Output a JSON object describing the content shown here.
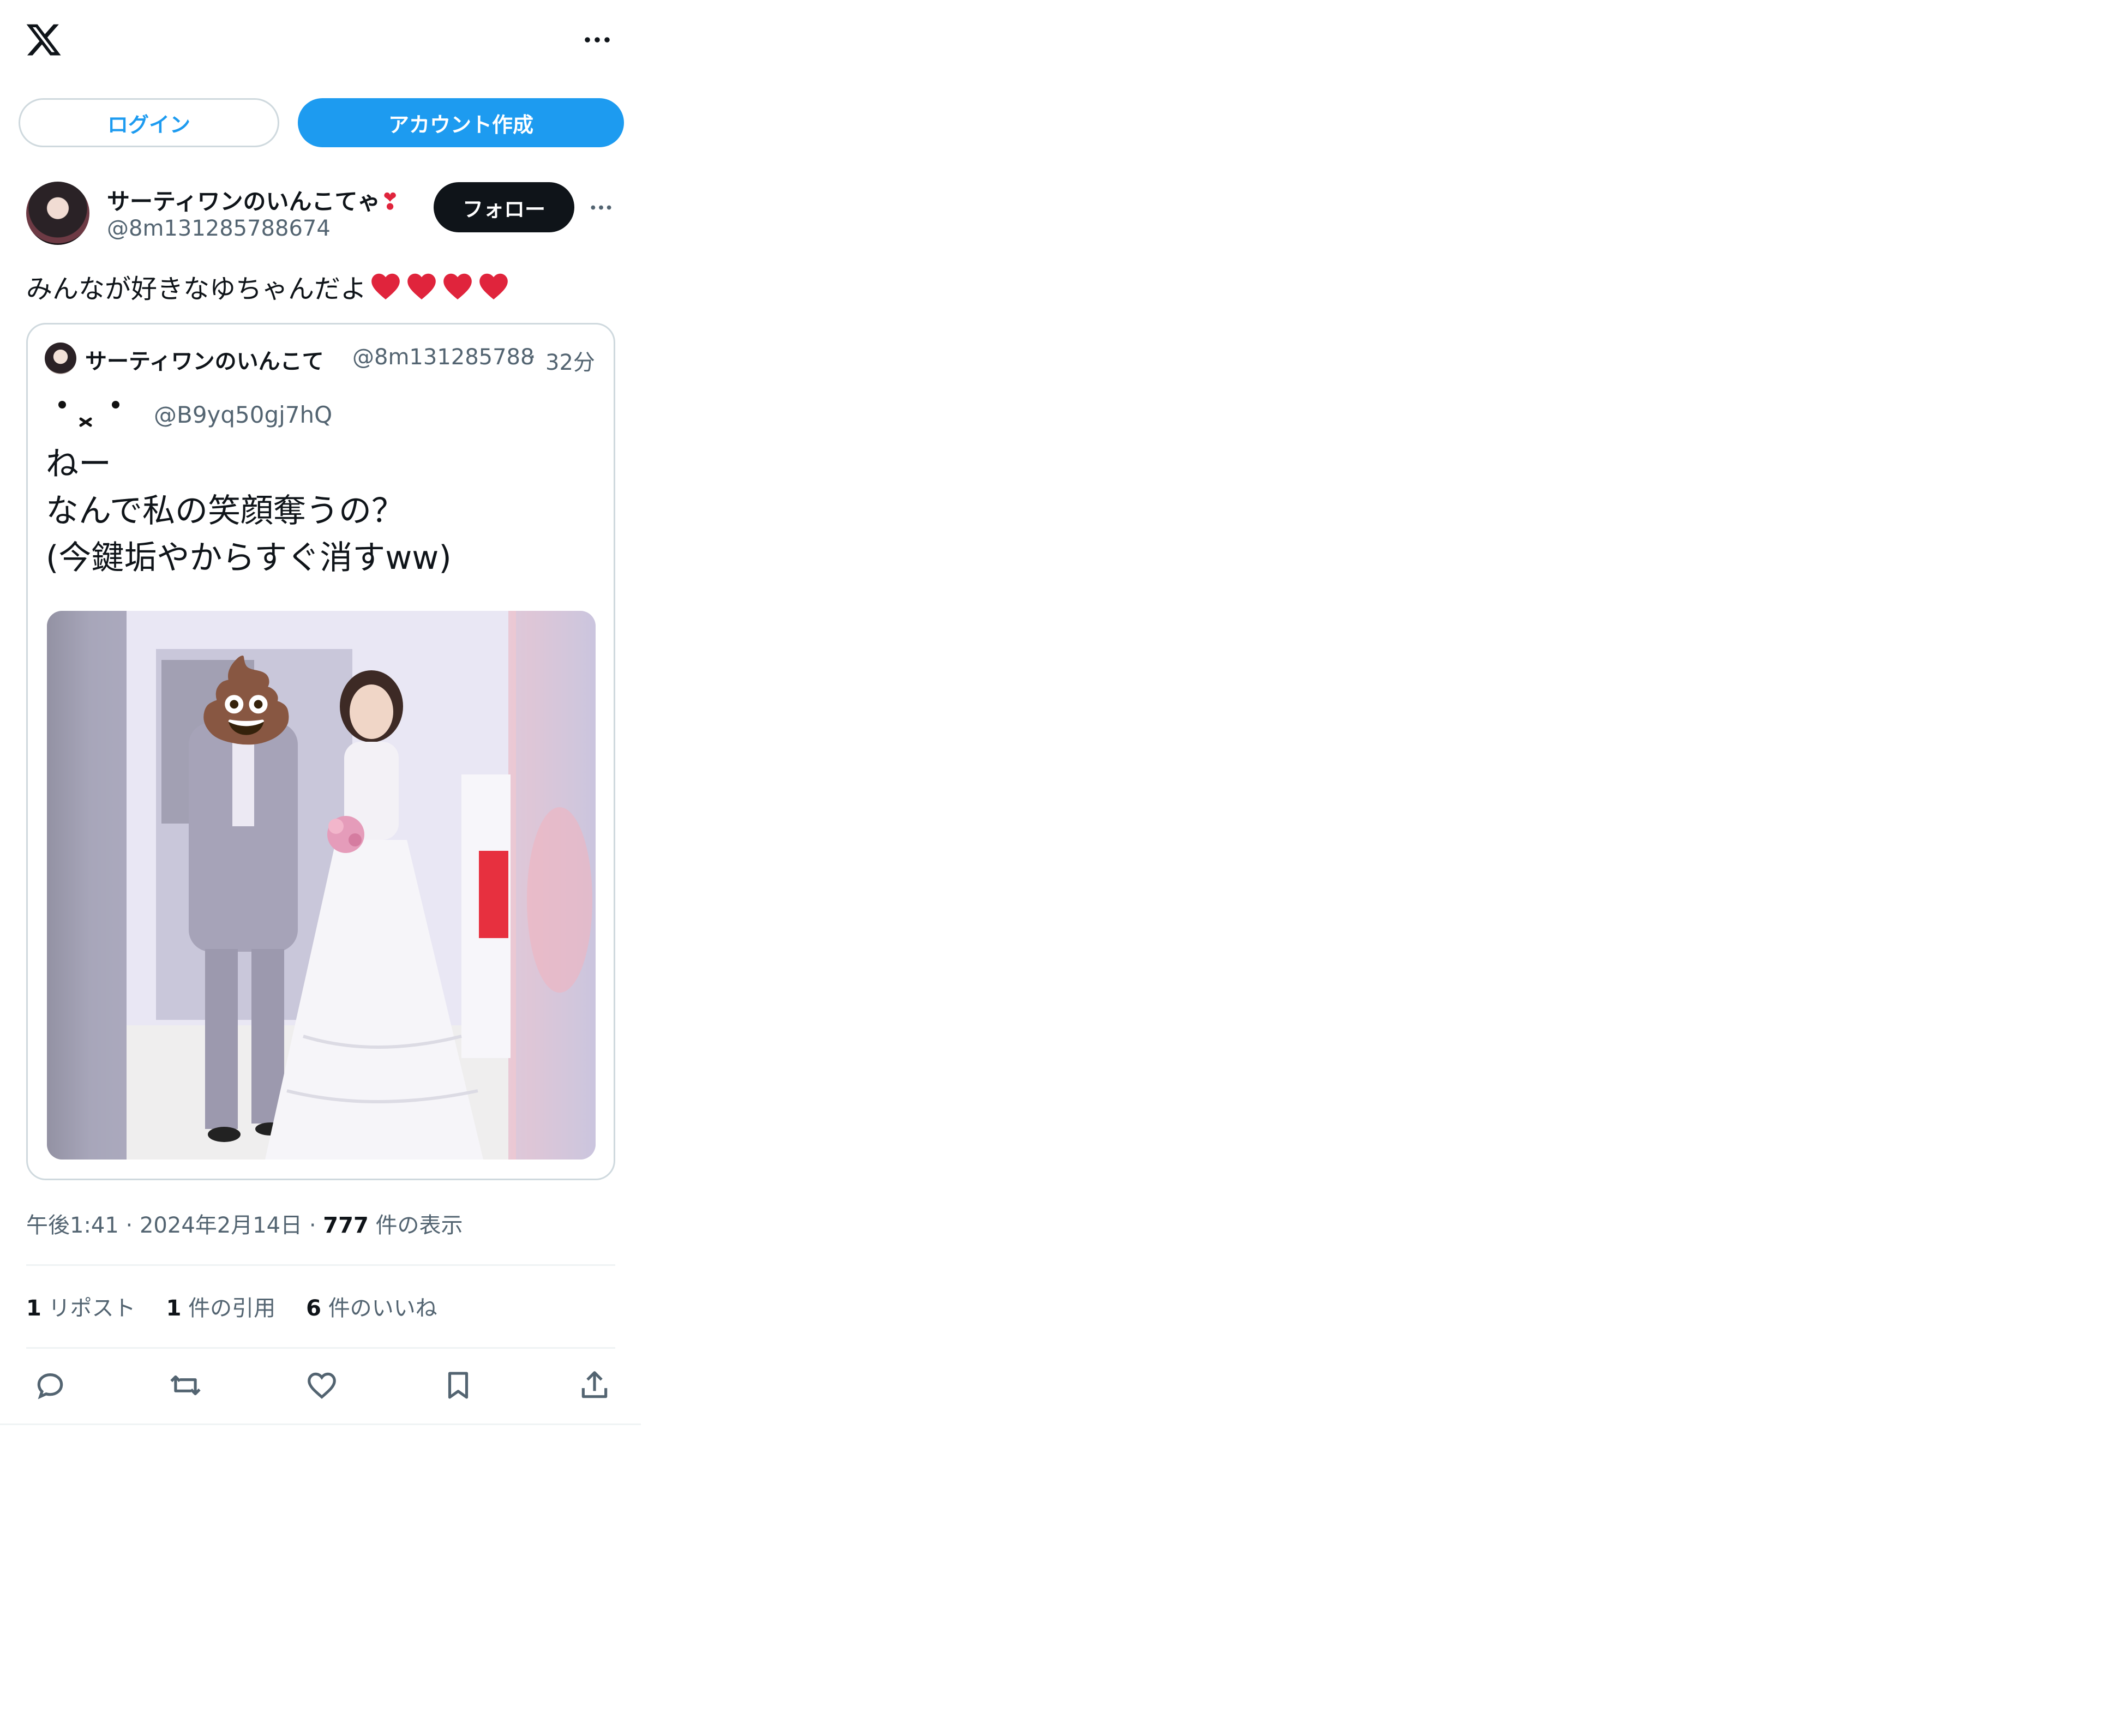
{
  "header": {
    "logo_icon": "x-logo-icon",
    "more_icon": "more-horizontal-icon"
  },
  "auth": {
    "login_label": "ログイン",
    "signup_label": "アカウント作成"
  },
  "post": {
    "author_name": "サーティワンのいんこてゃ",
    "author_name_emoji": "❣",
    "author_handle": "@8m131285788674",
    "follow_label": "フォロー",
    "text": "みんなが好きなゆちゃんだよ",
    "heart_count_icons": 4,
    "quote": {
      "author_name": "サーティワンのいんこて",
      "author_handle": "@8m131285788",
      "separator": "·",
      "time": "32分",
      "inner_handle": "@B9yq50gj7hQ",
      "inner_text": "ねー\nなんで私の笑顔奪うの？\n(今鍵垢やからすぐ消すww)",
      "image_emoji": "💩"
    },
    "meta": {
      "time": "午後1:41",
      "sep1": "·",
      "date": "2024年2月14日",
      "sep2": "·",
      "views_count": "777",
      "views_label": "件の表示"
    },
    "stats": {
      "reposts_count": "1",
      "reposts_label": "リポスト",
      "quotes_count": "1",
      "quotes_label": "件の引用",
      "likes_count": "6",
      "likes_label": "件のいいね"
    }
  },
  "colors": {
    "accent": "#1d9bf0",
    "text": "#0f1419",
    "secondary": "#536471",
    "border": "#cfd9de",
    "heart": "#e0243c"
  }
}
